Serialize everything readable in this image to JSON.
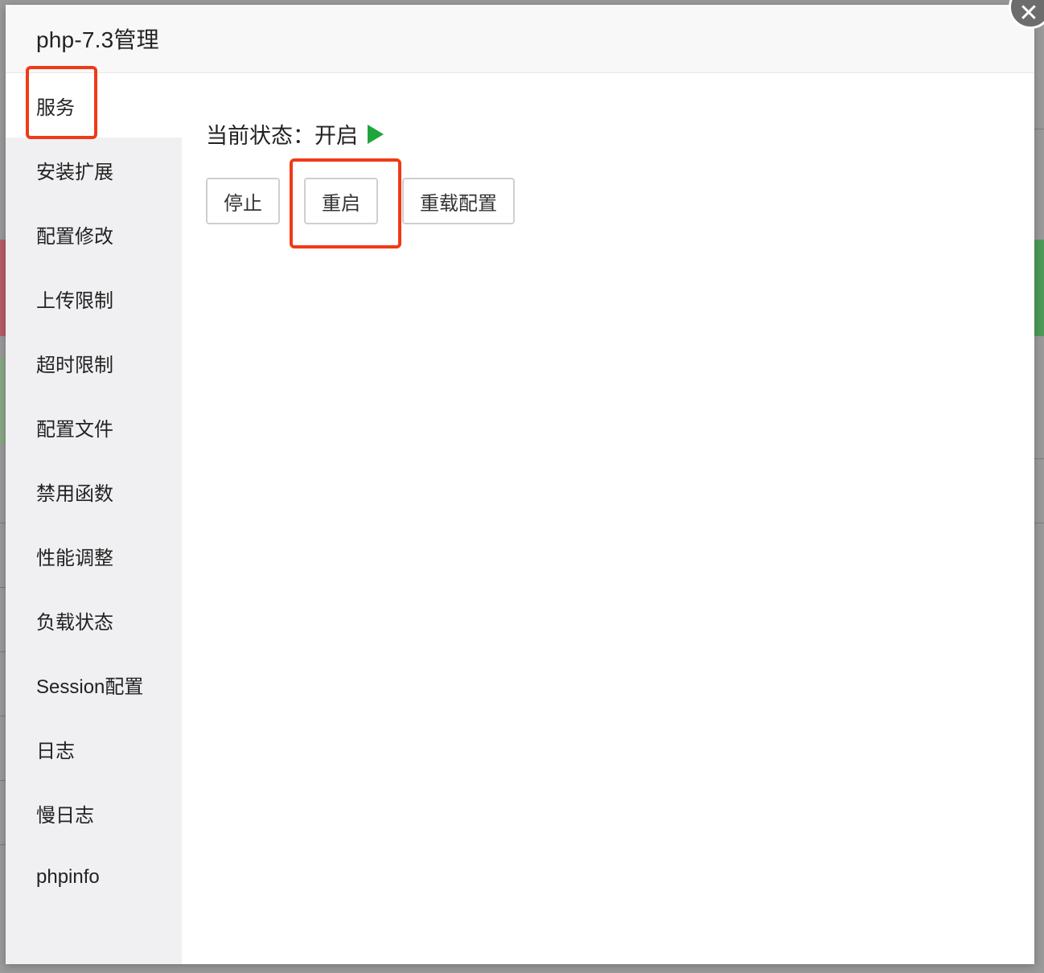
{
  "dialog": {
    "title": "php-7.3管理",
    "close_glyph": "✕"
  },
  "sidebar": {
    "items": [
      {
        "label": "服务"
      },
      {
        "label": "安装扩展"
      },
      {
        "label": "配置修改"
      },
      {
        "label": "上传限制"
      },
      {
        "label": "超时限制"
      },
      {
        "label": "配置文件"
      },
      {
        "label": "禁用函数"
      },
      {
        "label": "性能调整"
      },
      {
        "label": "负载状态"
      },
      {
        "label": "Session配置"
      },
      {
        "label": "日志"
      },
      {
        "label": "慢日志"
      },
      {
        "label": "phpinfo"
      }
    ],
    "active_index": 0
  },
  "main": {
    "status_text": "当前状态：开启",
    "status_icon": "play-icon",
    "status_color": "#20a53a",
    "buttons": {
      "stop": "停止",
      "restart": "重启",
      "reload": "重载配置"
    }
  },
  "annotation_color": "#f03a17"
}
